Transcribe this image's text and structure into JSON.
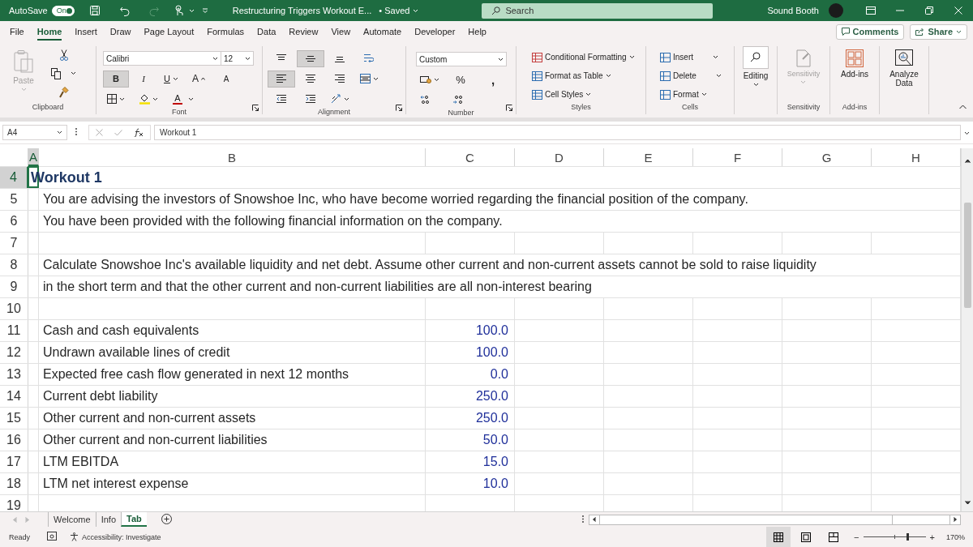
{
  "title_bar": {
    "autosave_label": "AutoSave",
    "autosave_toggle": {
      "label": "On",
      "on": true
    },
    "document_title": "Restructuring Triggers Workout E...",
    "save_status": "• Saved",
    "search": {
      "placeholder": "Search"
    },
    "user_name": "Sound Booth"
  },
  "menu_tabs": [
    {
      "label": "File",
      "selected": false
    },
    {
      "label": "Home",
      "selected": true
    },
    {
      "label": "Insert",
      "selected": false
    },
    {
      "label": "Draw",
      "selected": false
    },
    {
      "label": "Page Layout",
      "selected": false
    },
    {
      "label": "Formulas",
      "selected": false
    },
    {
      "label": "Data",
      "selected": false
    },
    {
      "label": "Review",
      "selected": false
    },
    {
      "label": "View",
      "selected": false
    },
    {
      "label": "Automate",
      "selected": false
    },
    {
      "label": "Developer",
      "selected": false
    },
    {
      "label": "Help",
      "selected": false
    }
  ],
  "comments_button": "Comments",
  "share_button": "Share",
  "ribbon": {
    "clipboard": {
      "paste_label": "Paste",
      "paste_disabled": true,
      "group_label": "Clipboard"
    },
    "font": {
      "font_name": "Calibri",
      "font_size": "12",
      "toggles": [
        {
          "kind": "bold",
          "label": "B",
          "selected": true
        },
        {
          "kind": "italic",
          "label": "I",
          "selected": false
        },
        {
          "kind": "underline",
          "label": "U",
          "selected": false
        }
      ],
      "grow_font": "A",
      "shrink_font": "A",
      "font_color": "A",
      "group_label": "Font"
    },
    "alignment": {
      "buttons": [
        {
          "kind": "top",
          "selected": false
        },
        {
          "kind": "middle",
          "selected": true
        },
        {
          "kind": "bottom",
          "selected": false
        },
        {
          "kind": "wrap",
          "selected": false
        },
        {
          "kind": "left",
          "selected": true
        },
        {
          "kind": "center",
          "selected": false
        },
        {
          "kind": "right",
          "selected": false
        },
        {
          "kind": "merge",
          "selected": false
        },
        {
          "kind": "outdent",
          "selected": false
        },
        {
          "kind": "indent",
          "selected": false
        },
        {
          "kind": "orientation",
          "selected": false
        }
      ],
      "group_label": "Alignment"
    },
    "number": {
      "format": "Custom",
      "percent": "%",
      "comma": ",",
      "group_label": "Number"
    },
    "styles": {
      "commands": [
        "Conditional Formatting",
        "Format as Table",
        "Cell Styles"
      ],
      "group_label": "Styles"
    },
    "cells": {
      "commands": [
        "Insert",
        "Delete",
        "Format"
      ],
      "group_label": "Cells"
    },
    "editing": {
      "label": "Editing"
    },
    "sensitivity": {
      "label": "Sensitivity",
      "disabled": true,
      "group_label": "Sensitivity"
    },
    "add_ins": {
      "label": "Add-ins",
      "group_label": "Add-ins"
    },
    "analyze": {
      "label": "Analyze Data"
    }
  },
  "formula_bar": {
    "name_box": "A4",
    "formula": "Workout 1"
  },
  "sheet": {
    "columns": [
      {
        "label": "A",
        "selected": true
      },
      {
        "label": "B",
        "selected": false
      },
      {
        "label": "C",
        "selected": false
      },
      {
        "label": "D",
        "selected": false
      },
      {
        "label": "E",
        "selected": false
      },
      {
        "label": "F",
        "selected": false
      },
      {
        "label": "G",
        "selected": false
      },
      {
        "label": "H",
        "selected": false
      }
    ],
    "rows": [
      {
        "number": "4",
        "selected": true,
        "a": "Workout 1"
      },
      {
        "number": "5",
        "selected": false,
        "b": "You are advising the investors of Snowshoe Inc, who have become worried regarding the financial position of the company."
      },
      {
        "number": "6",
        "selected": false,
        "b": "You have been provided with the following financial information on the company."
      },
      {
        "number": "7",
        "selected": false
      },
      {
        "number": "8",
        "selected": false,
        "b": "Calculate Snowshoe Inc's available liquidity and net debt. Assume other current and non-current assets cannot be sold to raise liquidity"
      },
      {
        "number": "9",
        "selected": false,
        "b": "in the short term and that the other current and non-current liabilities are all non-interest bearing"
      },
      {
        "number": "10",
        "selected": false
      },
      {
        "number": "11",
        "selected": false,
        "b": "Cash and  cash equivalents",
        "c": "100.0"
      },
      {
        "number": "12",
        "selected": false,
        "b": "Undrawn available lines of credit",
        "c": "100.0"
      },
      {
        "number": "13",
        "selected": false,
        "b": "Expected free cash flow generated in next 12 months",
        "c": "0.0"
      },
      {
        "number": "14",
        "selected": false,
        "b": "Current debt liability",
        "c": "250.0"
      },
      {
        "number": "15",
        "selected": false,
        "b": "Other current and non-current assets",
        "c": "250.0"
      },
      {
        "number": "16",
        "selected": false,
        "b": "Other current and non-current liabilities",
        "c": "50.0"
      },
      {
        "number": "17",
        "selected": false,
        "b": "LTM EBITDA",
        "c": "15.0"
      },
      {
        "number": "18",
        "selected": false,
        "b": "LTM net interest expense",
        "c": "10.0"
      },
      {
        "number": "19",
        "selected": false
      }
    ]
  },
  "sheet_tabs": [
    {
      "label": "Welcome",
      "selected": false
    },
    {
      "label": "Info",
      "selected": false
    },
    {
      "label": "Tab",
      "selected": true
    }
  ],
  "status_bar": {
    "mode": "Ready",
    "accessibility": "Accessibility: Investigate",
    "views": [
      {
        "kind": "normal",
        "selected": true
      },
      {
        "kind": "page-layout",
        "selected": false
      },
      {
        "kind": "page-break",
        "selected": false
      }
    ],
    "zoom_out": "−",
    "zoom_in": "+",
    "zoom": {
      "level": 0.71,
      "label": "170%"
    }
  }
}
